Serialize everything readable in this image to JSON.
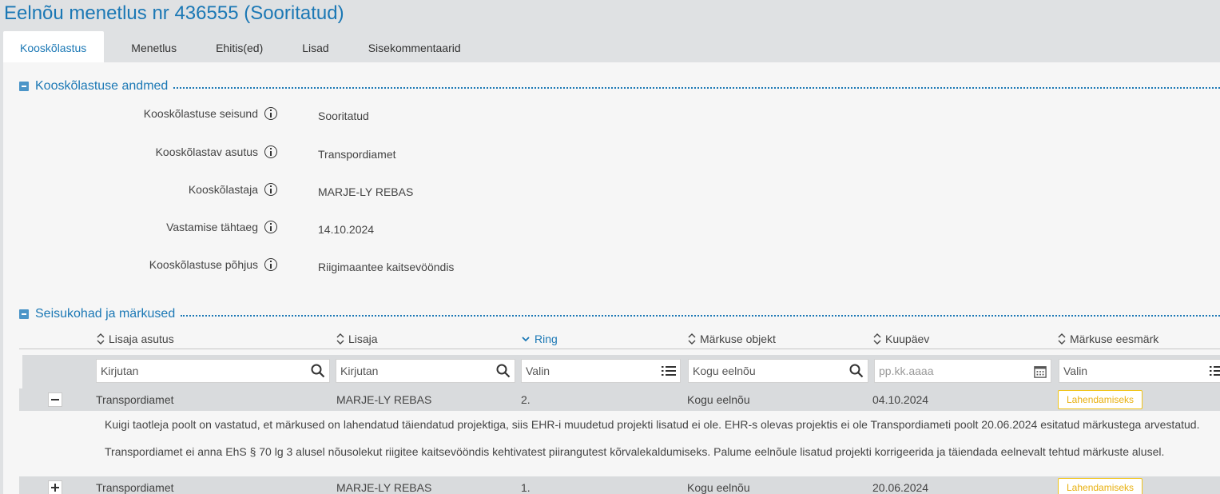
{
  "title": "Eelnõu menetlus nr 436555 (Sooritatud)",
  "tabs": [
    "Kooskõlastus",
    "Menetlus",
    "Ehitis(ed)",
    "Lisad",
    "Sisekommentaarid"
  ],
  "section1": {
    "title": "Kooskõlastuse andmed",
    "fields": [
      {
        "label": "Kooskõlastuse seisund",
        "value": "Sooritatud"
      },
      {
        "label": "Kooskõlastav asutus",
        "value": "Transpordiamet"
      },
      {
        "label": "Kooskõlastaja",
        "value": "MARJE-LY REBAS"
      },
      {
        "label": "Vastamise tähtaeg",
        "value": "14.10.2024"
      },
      {
        "label": "Kooskõlastuse põhjus",
        "value": "Riigimaantee kaitsevööndis"
      }
    ]
  },
  "section2": {
    "title": "Seisukohad ja märkused",
    "columns": [
      "Lisaja asutus",
      "Lisaja",
      "Ring",
      "Märkuse objekt",
      "Kuupäev",
      "Märkuse eesmärk"
    ],
    "filters": [
      "Kirjutan",
      "Kirjutan",
      "Valin",
      "Kogu eelnõu",
      "pp.kk.aaaa",
      "Valin"
    ],
    "rows": [
      {
        "asutus": "Transpordiamet",
        "lisaja": "MARJE-LY REBAS",
        "ring": "2.",
        "objekt": "Kogu eelnõu",
        "kuupaev": "04.10.2024",
        "eesmark": "Lahendamiseks",
        "text": [
          "Kuigi taotleja poolt on vastatud, et märkused on lahendatud täiendatud projektiga, siis EHR-i muudetud projekti lisatud ei ole. EHR-s olevas projektis ei ole Transpordiameti poolt 20.06.2024 esitatud märkustega arvestatud.",
          "Transpordiamet ei anna EhS § 70 lg 3 alusel nõusolekut riigitee kaitsevööndis kehtivatest piirangutest kõrvalekaldumiseks. Palume eelnõule lisatud projekti korrigeerida ja täiendada eelnevalt tehtud märkuste alusel."
        ]
      },
      {
        "asutus": "Transpordiamet",
        "lisaja": "MARJE-LY REBAS",
        "ring": "1.",
        "objekt": "Kogu eelnõu",
        "kuupaev": "20.06.2024",
        "eesmark": "Lahendamiseks"
      }
    ]
  }
}
